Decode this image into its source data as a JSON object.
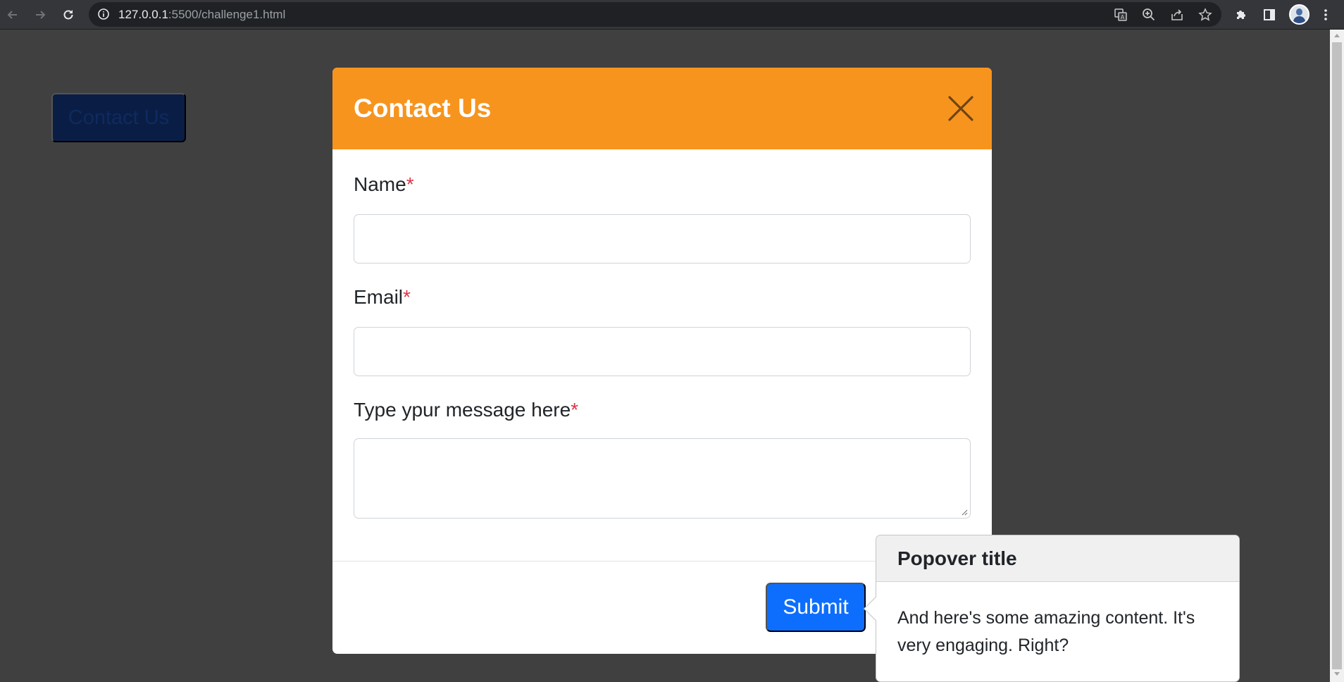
{
  "browser": {
    "url_host": "127.0.0.1",
    "url_rest": ":5500/challenge1.html",
    "icons": {
      "back": "arrow-left-icon",
      "forward": "arrow-right-icon",
      "reload": "reload-icon",
      "site_info": "info-icon",
      "translate": "translate-icon",
      "zoom": "zoom-icon",
      "share": "share-icon",
      "bookmark": "star-icon",
      "extensions": "puzzle-icon",
      "side_panel": "side-panel-icon",
      "menu": "kebab-menu-icon"
    }
  },
  "page": {
    "contact_button_label": "Contact Us"
  },
  "modal": {
    "title": "Contact Us",
    "close_icon": "close-icon",
    "fields": {
      "name_label": "Name",
      "email_label": "Email",
      "message_label": "Type ypur message here",
      "required_mark": "*",
      "name_value": "",
      "email_value": "",
      "message_value": ""
    },
    "submit_label": "Submit"
  },
  "popover": {
    "title": "Popover title",
    "body": "And here's some amazing content. It's very engaging. Right?"
  },
  "colors": {
    "header_orange": "#f7941e",
    "primary_blue": "#0d6efd",
    "required_red": "#dc3545",
    "backdrop": "#404040"
  }
}
